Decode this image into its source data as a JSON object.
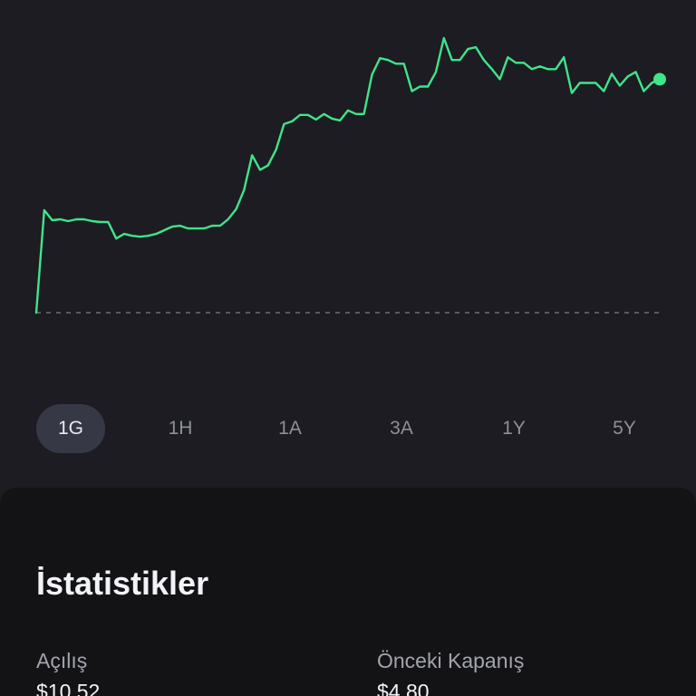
{
  "colors": {
    "background": "#1c1c22",
    "card": "#131316",
    "line": "#3ee58a",
    "baseline": "#6b6e7a",
    "tab_active_bg": "#363945"
  },
  "chart_data": {
    "type": "line",
    "y": [
      0,
      11.2,
      10.1,
      10.2,
      10.0,
      10.2,
      10.2,
      10.0,
      9.9,
      9.9,
      8.1,
      8.6,
      8.4,
      8.3,
      8.4,
      8.6,
      9.0,
      9.4,
      9.5,
      9.2,
      9.2,
      9.2,
      9.5,
      9.5,
      10.2,
      11.3,
      13.4,
      17.2,
      15.6,
      16.1,
      17.8,
      20.6,
      20.9,
      21.6,
      21.6,
      21.1,
      21.7,
      21.2,
      21.0,
      22.1,
      21.7,
      21.7,
      26.0,
      27.8,
      27.6,
      27.2,
      27.2,
      24.2,
      24.7,
      24.7,
      26.3,
      30.0,
      27.6,
      27.6,
      28.8,
      29.0,
      27.6,
      26.6,
      25.5,
      27.9,
      27.3,
      27.3,
      26.6,
      26.9,
      26.6,
      26.6,
      27.9,
      24.0,
      25.1,
      25.1,
      25.1,
      24.2,
      26.1,
      24.8,
      25.8,
      26.3,
      24.2,
      25.1,
      25.5
    ],
    "baseline": 0,
    "current_point_marker": true,
    "grid": false
  },
  "range_tabs": [
    {
      "label": "1G",
      "active": true
    },
    {
      "label": "1H",
      "active": false
    },
    {
      "label": "1A",
      "active": false
    },
    {
      "label": "3A",
      "active": false
    },
    {
      "label": "1Y",
      "active": false
    },
    {
      "label": "5Y",
      "active": false
    }
  ],
  "stats": {
    "title": "İstatistikler",
    "items": [
      {
        "label": "Açılış",
        "value": "$10.52"
      },
      {
        "label": "Önceki Kapanış",
        "value": "$4.80"
      }
    ]
  }
}
